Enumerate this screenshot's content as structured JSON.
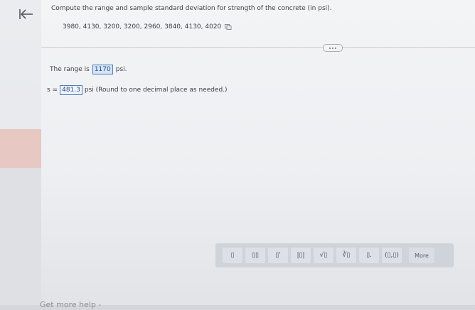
{
  "question": {
    "prompt": "Compute the range and sample standard deviation for strength of the concrete (in psi).",
    "data_values": "3980, 4130, 3200, 3200, 2960, 3840, 4130, 4020"
  },
  "answers": {
    "range_prefix": "The range is",
    "range_value": "1170",
    "range_unit": "psi.",
    "s_prefix": "s =",
    "s_value": "481.3",
    "s_suffix": "psi (Round to one decimal place as needed.)"
  },
  "toolbar": {
    "buttons": [
      "▯",
      "▯▯",
      "▯'",
      "|▯|",
      "√▯",
      "∛▯",
      "▯.",
      "(▯,▯)"
    ],
    "more_label": "More"
  },
  "footer": {
    "help_label": "Get more help -"
  },
  "icons": [
    "back-arrow-icon",
    "copy-data-icon",
    "expand-dots-icon"
  ],
  "colors": {
    "accent": "#4d7fc0",
    "answer_fill": "#d4e3f7",
    "rail_accent": "#e8c8c3"
  }
}
